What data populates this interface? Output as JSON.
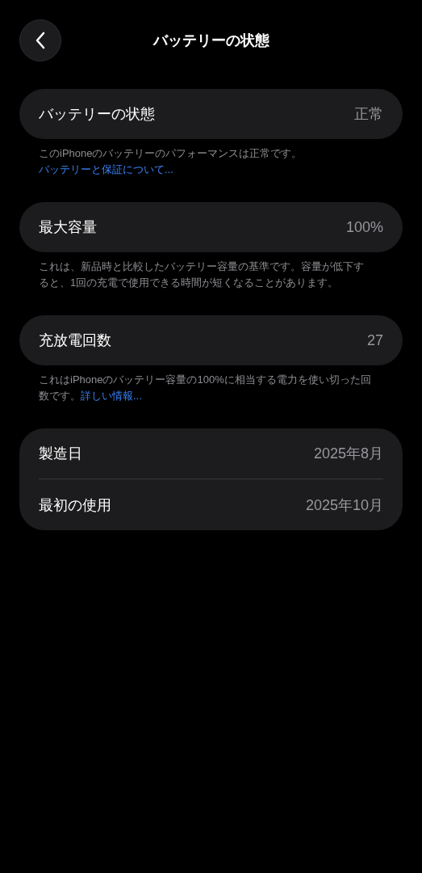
{
  "header": {
    "title": "バッテリーの状態"
  },
  "sections": [
    {
      "rows": [
        {
          "label": "バッテリーの状態",
          "value": "正常"
        }
      ],
      "note": {
        "text": "このiPhoneのバッテリーのパフォーマンスは正常です。",
        "link": "バッテリーと保証について..."
      }
    },
    {
      "rows": [
        {
          "label": "最大容量",
          "value": "100%"
        }
      ],
      "note": {
        "text": "これは、新品時と比較したバッテリー容量の基準です。容量が低下すると、1回の充電で使用できる時間が短くなることがあります。"
      }
    },
    {
      "rows": [
        {
          "label": "充放電回数",
          "value": "27"
        }
      ],
      "note": {
        "text": "これはiPhoneのバッテリー容量の100%に相当する電力を使い切った回数です。",
        "link": "詳しい情報..."
      }
    },
    {
      "rows": [
        {
          "label": "製造日",
          "value": "2025年8月"
        },
        {
          "label": "最初の使用",
          "value": "2025年10月"
        }
      ]
    }
  ]
}
